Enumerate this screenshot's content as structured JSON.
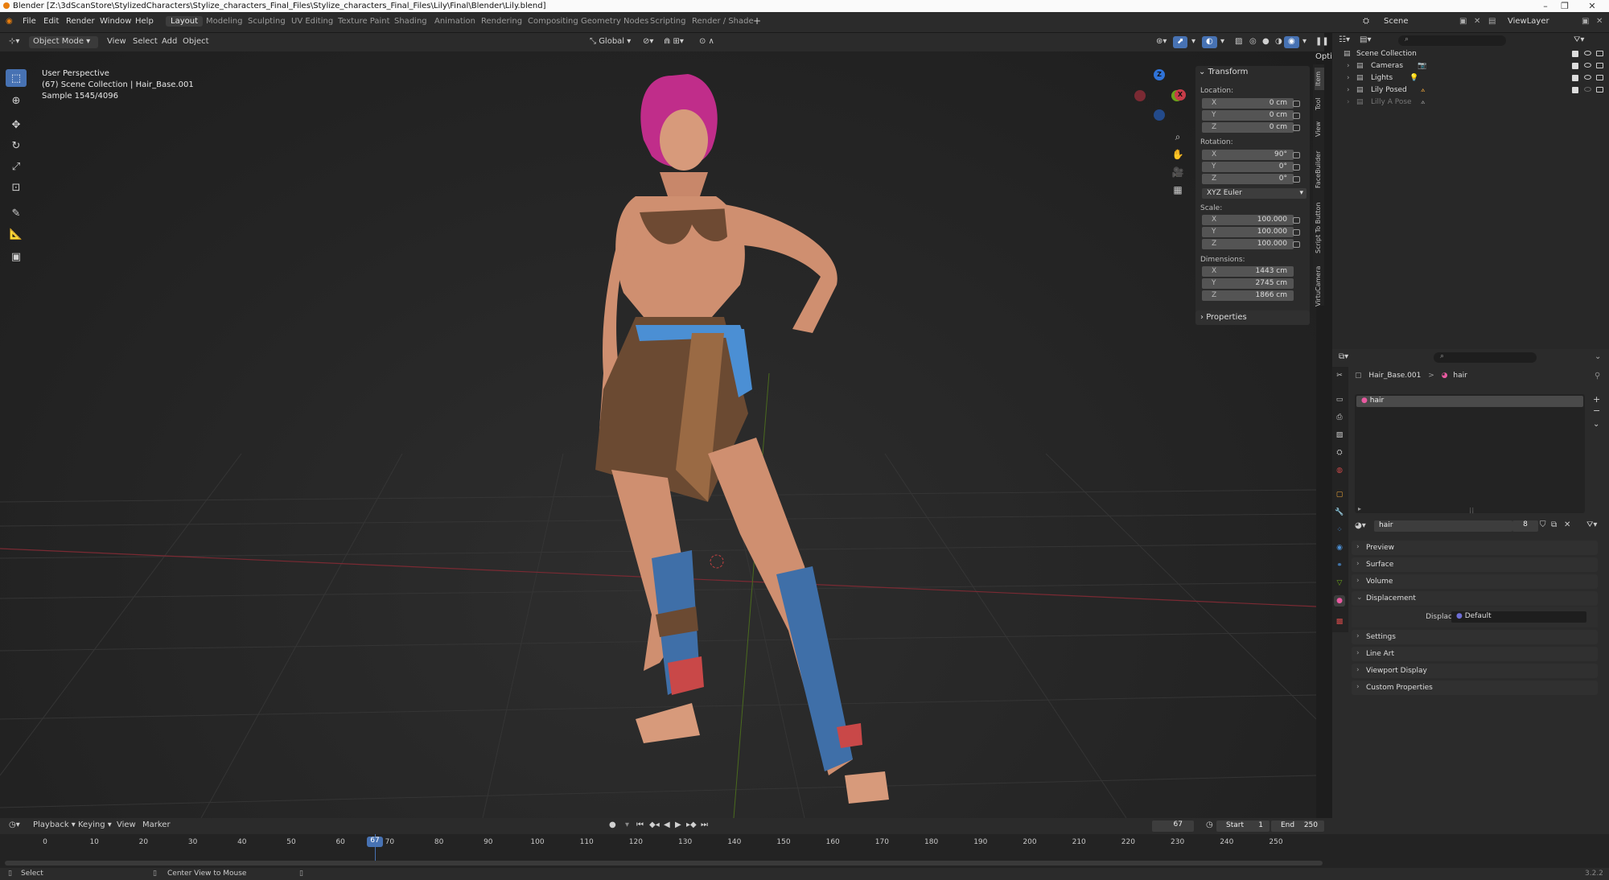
{
  "window": {
    "title": "Blender [Z:\\3dScanStore\\StylizedCharacters\\Stylize_characters_Final_Files\\Stylize_characters_Final_Files\\Lily\\Final\\Blender\\Lily.blend]",
    "minimize": "–",
    "maximize": "❐",
    "close": "✕"
  },
  "menu": {
    "file": "File",
    "edit": "Edit",
    "render": "Render",
    "window": "Window",
    "help": "Help"
  },
  "workspaces": [
    "Layout",
    "Modeling",
    "Sculpting",
    "UV Editing",
    "Texture Paint",
    "Shading",
    "Animation",
    "Rendering",
    "Compositing",
    "Geometry Nodes",
    "Scripting",
    "Render / Shade"
  ],
  "workspace_add": "+",
  "scene": {
    "label": "Scene"
  },
  "viewlayer": {
    "label": "ViewLayer"
  },
  "viewport_header": {
    "mode": "Object Mode",
    "view": "View",
    "select": "Select",
    "add": "Add",
    "object": "Object",
    "orientation": "Global",
    "options": "Options"
  },
  "overlay_text": {
    "perspective": "User Perspective",
    "collection": "(67) Scene Collection | Hair_Base.001",
    "sample": "Sample 1545/4096"
  },
  "gizmo": {
    "z": "Z",
    "y": "Y",
    "x": "X"
  },
  "npanel": {
    "transform": "Transform",
    "location_label": "Location:",
    "location": [
      {
        "axis": "X",
        "value": "0 cm"
      },
      {
        "axis": "Y",
        "value": "0 cm"
      },
      {
        "axis": "Z",
        "value": "0 cm"
      }
    ],
    "rotation_label": "Rotation:",
    "rotation": [
      {
        "axis": "X",
        "value": "90°"
      },
      {
        "axis": "Y",
        "value": "0°"
      },
      {
        "axis": "Z",
        "value": "0°"
      }
    ],
    "rotation_mode": "XYZ Euler",
    "scale_label": "Scale:",
    "scale": [
      {
        "axis": "X",
        "value": "100.000"
      },
      {
        "axis": "Y",
        "value": "100.000"
      },
      {
        "axis": "Z",
        "value": "100.000"
      }
    ],
    "dimensions_label": "Dimensions:",
    "dimensions": [
      {
        "axis": "X",
        "value": "1443 cm"
      },
      {
        "axis": "Y",
        "value": "2745 cm"
      },
      {
        "axis": "Z",
        "value": "1866 cm"
      }
    ],
    "properties": "Properties",
    "tabs": [
      "Item",
      "Tool",
      "View",
      "FaceBuilder",
      "Script To Button",
      "VirtuCamera"
    ]
  },
  "outliner": {
    "root": "Scene Collection",
    "items": [
      {
        "label": "Cameras",
        "dim": false
      },
      {
        "label": "Lights",
        "dim": false
      },
      {
        "label": "Lily Posed",
        "dim": false
      },
      {
        "label": "Lilly A Pose",
        "dim": true
      }
    ]
  },
  "properties": {
    "breadcrumb_object": "Hair_Base.001",
    "breadcrumb_sep": ">",
    "breadcrumb_material": "hair",
    "slot": "hair",
    "material_name": "hair",
    "users": "8",
    "sections": [
      "Preview",
      "Surface",
      "Volume",
      "Displacement",
      "Settings",
      "Line Art",
      "Viewport Display",
      "Custom Properties"
    ],
    "displacement_label": "Displacement",
    "displacement_value": "Default"
  },
  "timeline": {
    "playback": "Playback",
    "keying": "Keying",
    "view": "View",
    "marker": "Marker",
    "current_frame": "67",
    "start_label": "Start",
    "start": "1",
    "end_label": "End",
    "end": "250",
    "ticks": [
      "0",
      "10",
      "20",
      "30",
      "40",
      "50",
      "60",
      "70",
      "80",
      "90",
      "100",
      "110",
      "120",
      "130",
      "140",
      "150",
      "160",
      "170",
      "180",
      "190",
      "200",
      "210",
      "220",
      "230",
      "240",
      "250"
    ]
  },
  "status": {
    "select": "Select",
    "center": "Center View to Mouse",
    "version": "3.2.2"
  },
  "colors": {
    "accent": "#4772b3",
    "active_frame": "#4772b3",
    "x_axis": "#c73c48",
    "y_axis": "#6ba21a",
    "z_axis": "#2f73d8"
  }
}
